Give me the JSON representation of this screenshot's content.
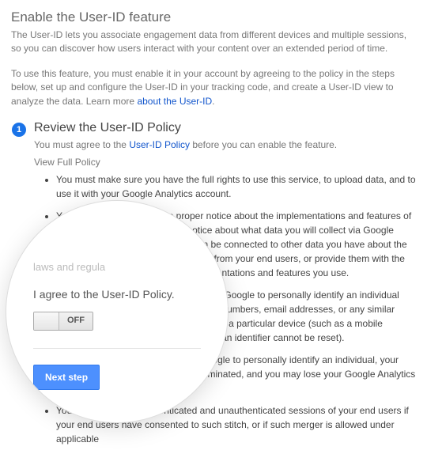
{
  "heading": "Enable the User-ID feature",
  "intro1": "The User-ID lets you associate engagement data from different devices and multiple sessions, so you can discover how users interact with your content over an extended period of time.",
  "intro2_pre": "To use this feature, you must enable it in your account by agreeing to the policy in the steps below, set up and configure the User-ID in your tracking code, and create a User-ID view to analyze the data. Learn more ",
  "intro2_link": "about the User-ID",
  "intro2_post": ".",
  "step1": {
    "num": "1",
    "title": "Review the User-ID Policy",
    "sub_pre": "You must agree to the ",
    "sub_link": "User-ID Policy",
    "sub_post": " before you can enable the feature.",
    "view_policy": "View Full Policy",
    "bullets": [
      "You must make sure you have the full rights to use this service, to upload data, and to use it with your Google Analytics account.",
      "You will give your end users proper notice about the implementations and features of Google Analytics you use (e.g. notice about what data you will collect via Google Analytics, and whether this data can be connected to other data you have about the end user). You will either get consent from your end users, or provide them with the opportunity to opt-out from the implementations and features you use.",
      "You will not upload any data that allows Google to personally identify an individual (such as certain names, social security numbers, email addresses, or any similar data), or data that permanently identifies a particular device (such as a mobile phone's unique device identifier if such an identifier cannot be reset).",
      "If you upload any data that allows Google to personally identify an individual, your Google Analytics account can be terminated, and you may lose your Google Analytics data.",
      "You will only merge authenticated and unauthenticated sessions of your end users if your end users have consented to such stitch, or if such merger is allowed under applicable"
    ]
  },
  "magnifier": {
    "faint_text": "laws and regula",
    "agree_text": "I agree to the User-ID Policy.",
    "toggle_state": "OFF",
    "next_button": "Next step"
  }
}
